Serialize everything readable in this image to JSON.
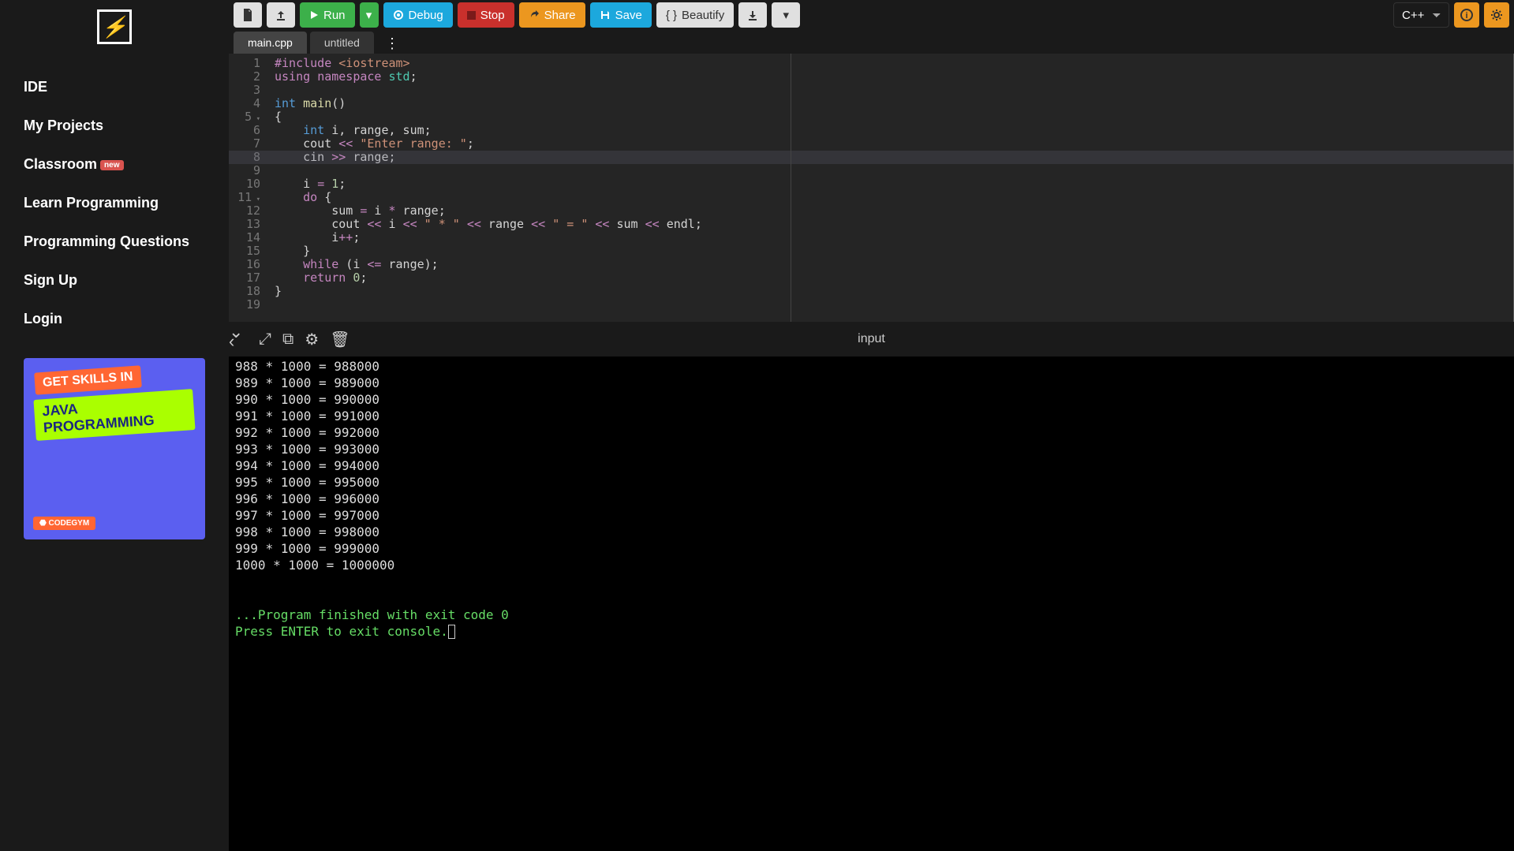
{
  "sidebar": {
    "nav": [
      {
        "label": "IDE"
      },
      {
        "label": "My Projects"
      },
      {
        "label": "Classroom",
        "badge": "new"
      },
      {
        "label": "Learn Programming"
      },
      {
        "label": "Programming Questions"
      },
      {
        "label": "Sign Up"
      },
      {
        "label": "Login"
      }
    ],
    "promo": {
      "line1": "GET SKILLS IN",
      "line2": "JAVA PROGRAMMING",
      "brand": "⬣ CODEGYM"
    }
  },
  "toolbar": {
    "run": "Run",
    "debug": "Debug",
    "stop": "Stop",
    "share": "Share",
    "save": "Save",
    "beautify": "Beautify",
    "language": "C++"
  },
  "tabs": [
    {
      "label": "main.cpp",
      "active": true
    },
    {
      "label": "untitled",
      "active": false
    }
  ],
  "editor": {
    "highlighted_line": 8,
    "lines": [
      {
        "n": 1,
        "html": "<span class='include'>#include</span> <span class='hdr'>&lt;iostream&gt;</span>"
      },
      {
        "n": 2,
        "html": "<span class='kw-red'>using</span> <span class='kw-red'>namespace</span> <span class='type'>std</span>;"
      },
      {
        "n": 3,
        "html": ""
      },
      {
        "n": 4,
        "html": "<span class='kw-blue'>int</span> <span class='fn'>main</span>()"
      },
      {
        "n": 5,
        "html": "{",
        "fold": true
      },
      {
        "n": 6,
        "html": "    <span class='kw-blue'>int</span> i, range, sum;"
      },
      {
        "n": 7,
        "html": "    cout <span class='kw-red'>&lt;&lt;</span> <span class='str'>\"Enter range: \"</span>;"
      },
      {
        "n": 8,
        "html": "    cin <span class='kw-red'>&gt;&gt;</span> range;"
      },
      {
        "n": 9,
        "html": ""
      },
      {
        "n": 10,
        "html": "    i <span class='kw-red'>=</span> <span class='num'>1</span>;"
      },
      {
        "n": 11,
        "html": "    <span class='kw-red'>do</span> {",
        "fold": true
      },
      {
        "n": 12,
        "html": "        sum <span class='kw-red'>=</span> i <span class='kw-red'>*</span> range;"
      },
      {
        "n": 13,
        "html": "        cout <span class='kw-red'>&lt;&lt;</span> i <span class='kw-red'>&lt;&lt;</span> <span class='str'>\" * \"</span> <span class='kw-red'>&lt;&lt;</span> range <span class='kw-red'>&lt;&lt;</span> <span class='str'>\" = \"</span> <span class='kw-red'>&lt;&lt;</span> sum <span class='kw-red'>&lt;&lt;</span> endl;"
      },
      {
        "n": 14,
        "html": "        i<span class='kw-red'>++</span>;"
      },
      {
        "n": 15,
        "html": "    }"
      },
      {
        "n": 16,
        "html": "    <span class='kw-red'>while</span> (i <span class='kw-red'>&lt;=</span> range);"
      },
      {
        "n": 17,
        "html": "    <span class='kw-red'>return</span> <span class='num'>0</span>;"
      },
      {
        "n": 18,
        "html": "}"
      },
      {
        "n": 19,
        "html": ""
      }
    ]
  },
  "output": {
    "input_label": "input",
    "lines": [
      "988 * 1000 = 988000",
      "989 * 1000 = 989000",
      "990 * 1000 = 990000",
      "991 * 1000 = 991000",
      "992 * 1000 = 992000",
      "993 * 1000 = 993000",
      "994 * 1000 = 994000",
      "995 * 1000 = 995000",
      "996 * 1000 = 996000",
      "997 * 1000 = 997000",
      "998 * 1000 = 998000",
      "999 * 1000 = 999000",
      "1000 * 1000 = 1000000"
    ],
    "finish1": "...Program finished with exit code 0",
    "finish2": "Press ENTER to exit console."
  }
}
